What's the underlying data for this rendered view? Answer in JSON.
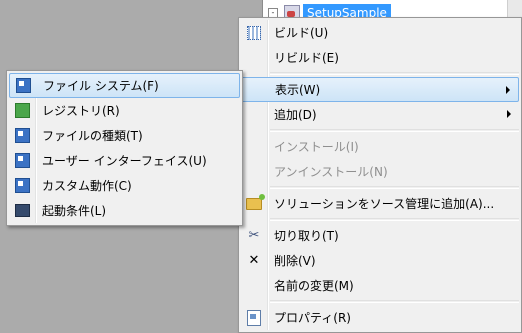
{
  "explorer": {
    "expander": "-",
    "selected_node": "SetupSample"
  },
  "context_menu": {
    "items": [
      {
        "label": "ビルド(U)",
        "icon": "build-icon"
      },
      {
        "label": "リビルド(E)",
        "icon": ""
      },
      {
        "label": "表示(W)",
        "icon": "",
        "submenu": true
      },
      {
        "label": "追加(D)",
        "icon": "",
        "submenu": true
      },
      {
        "label": "インストール(I)",
        "icon": "",
        "disabled": true
      },
      {
        "label": "アンインストール(N)",
        "icon": "",
        "disabled": true
      },
      {
        "label": "ソリューションをソース管理に追加(A)...",
        "icon": "add-to-source-control-icon"
      },
      {
        "label": "切り取り(T)",
        "icon": "cut-icon"
      },
      {
        "label": "削除(V)",
        "icon": "delete-icon"
      },
      {
        "label": "名前の変更(M)",
        "icon": ""
      },
      {
        "label": "プロパティ(R)",
        "icon": "properties-icon"
      }
    ],
    "glyphs": {
      "cut": "✂",
      "delete": "✕"
    }
  },
  "view_submenu": {
    "items": [
      {
        "label": "ファイル システム(F)",
        "icon": "file-system-icon"
      },
      {
        "label": "レジストリ(R)",
        "icon": "registry-icon"
      },
      {
        "label": "ファイルの種類(T)",
        "icon": "file-types-icon"
      },
      {
        "label": "ユーザー インターフェイス(U)",
        "icon": "user-interface-icon"
      },
      {
        "label": "カスタム動作(C)",
        "icon": "custom-actions-icon"
      },
      {
        "label": "起動条件(L)",
        "icon": "launch-conditions-icon"
      }
    ]
  },
  "colors": {
    "highlight_border": "#7eb4ea",
    "selection_blue": "#3399ff",
    "disabled_text": "#8f8f8f"
  }
}
